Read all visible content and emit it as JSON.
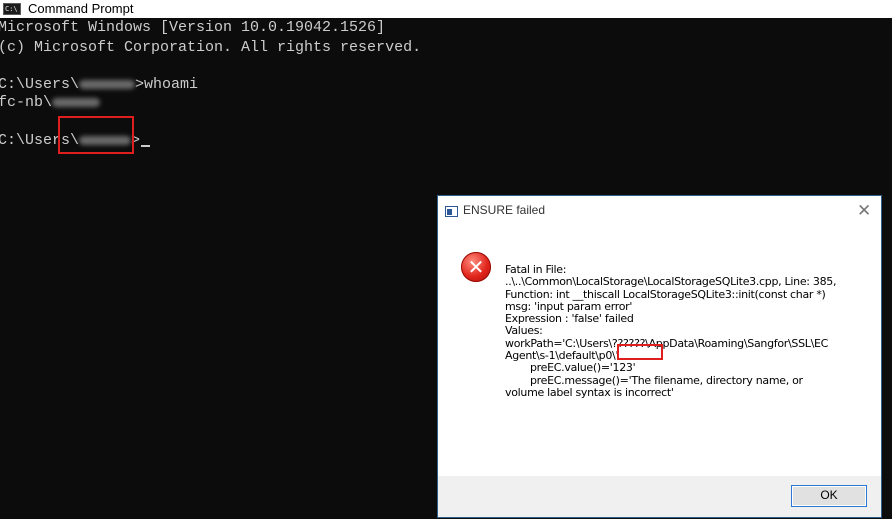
{
  "window": {
    "title": "Command Prompt",
    "icon": "console-icon"
  },
  "console": {
    "line1": "Microsoft Windows [Version 10.0.19042.1526]",
    "line2": "(c) Microsoft Corporation. All rights reserved.",
    "prompt1_prefix": "C:\\Users\\",
    "prompt1_suffix": ">whoami",
    "output_prefix": "fc-nb\\",
    "prompt2_prefix": "C:\\Users\\",
    "prompt2_suffix": ">"
  },
  "dialog": {
    "title": "ENSURE failed",
    "close_icon": "close-icon",
    "error_icon": "error-icon",
    "message_lines": [
      "Fatal in File:",
      "..\\..\\Common\\LocalStorage\\LocalStorageSQLite3.cpp, Line: 385,",
      "Function: int __thiscall LocalStorageSQLite3::init(const char *)",
      "msg: 'input param error'",
      "Expression : 'false' failed",
      "Values:",
      "workPath='C:\\Users\\??????\\AppData\\Roaming\\Sangfor\\SSL\\EC",
      "Agent\\s-1\\default\\p0\\'",
      "preEC.value()='123'",
      "preEC.message()='The filename, directory name, or",
      "volume label syntax is incorrect'"
    ],
    "ok_label": "OK"
  },
  "colors": {
    "console_bg": "#0c0c0c",
    "console_text": "#cccccc",
    "highlight": "#e11e1e",
    "dialog_border": "#2f5f8f",
    "ok_border": "#2d78d7"
  }
}
